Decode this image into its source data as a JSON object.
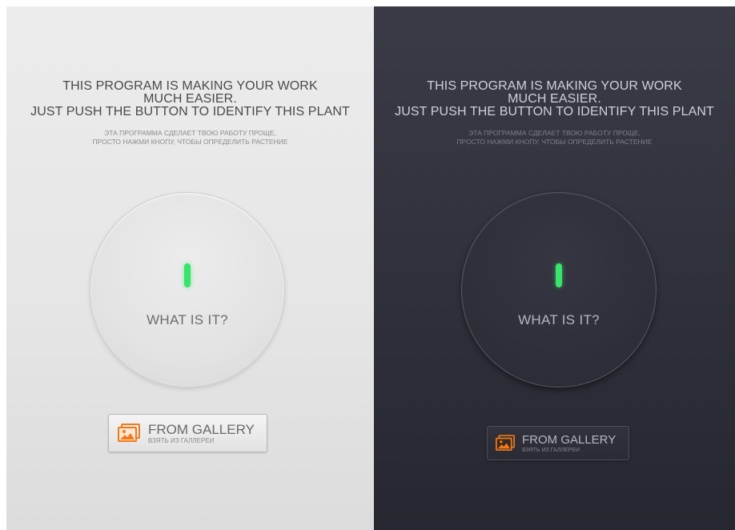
{
  "headline": {
    "line1": "THIS PROGRAM IS MAKING YOUR WORK",
    "line2": "MUCH EASIER.",
    "line3": "JUST PUSH THE BUTTON TO IDENTIFY THIS PLANT"
  },
  "subline": {
    "line1": "ЭТА ПРОГРАММА СДЕЛАЕТ ТВОЮ РАБОТУ ПРОЩЕ,",
    "line2": "ПРОСТО НАЖМИ КНОПУ, ЧТОБЫ ОПРЕДЕЛИТЬ РАСТЕНИЕ"
  },
  "identify_button": {
    "label": "WHAT IS IT?",
    "indicator_color": "#38e46a"
  },
  "gallery_button": {
    "label": "FROM GALLERY",
    "sublabel": "ВЗЯТЬ ИЗ ГАЛЛЕРЕИ",
    "icon": "gallery-image-icon",
    "icon_color": "#f07a1a"
  },
  "themes": {
    "light": {
      "background": "#e6e6e6"
    },
    "dark": {
      "background": "#30313b"
    }
  }
}
